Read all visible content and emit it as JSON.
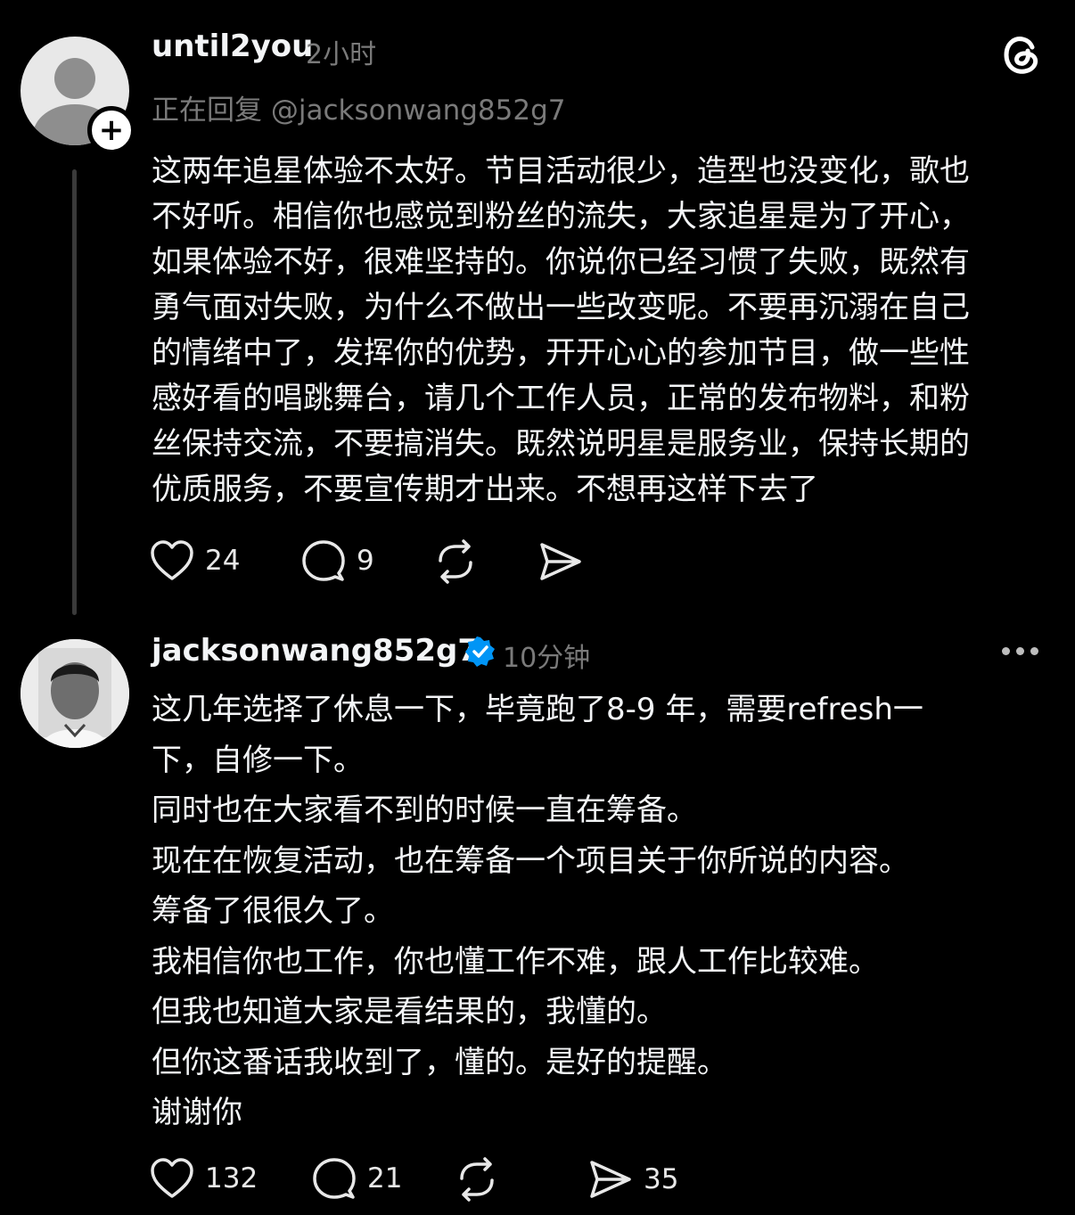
{
  "post": {
    "username": "until2you",
    "time": "2小时",
    "reply_to": "正在回复 @jacksonwang852g7",
    "lines": [
      "这两年追星体验不太好。节目活动很少，造型也没变化，歌也",
      "不好听。相信你也感觉到粉丝的流失，大家追星是为了开心，",
      "如果体验不好，很难坚持的。你说你已经习惯了失败，既然有",
      "勇气面对失败，为什么不做出一些改变呢。不要再沉溺在自己",
      "的情绪中了，发挥你的优势，开开心心的参加节目，做一些性",
      "感好看的唱跳舞台，请几个工作人员，正常的发布物料，和粉",
      "丝保持交流，不要搞消失。既然说明星是服务业，保持长期的",
      "优质服务，不要宣传期才出来。不想再这样下去了"
    ],
    "likes": "24",
    "replies": "9"
  },
  "reply": {
    "username": "jacksonwang852g7",
    "time": "10分钟",
    "lines": [
      "这几年选择了休息一下，毕竟跑了8-9 年，需要refresh一",
      "下，自修一下。",
      "同时也在大家看不到的时候一直在筹备。",
      "现在在恢复活动，也在筹备一个项目关于你所说的内容。",
      "筹备了很很久了。",
      "我相信你也工作，你也懂工作不难，跟人工作比较难。",
      "但我也知道大家是看结果的，我懂的。",
      "但你这番话我收到了，懂的。是好的提醒。",
      "谢谢你"
    ],
    "likes": "132",
    "replies": "21",
    "shares": "35"
  },
  "icons": {
    "like": "heart-icon",
    "comment": "comment-icon",
    "repost": "repost-icon",
    "share": "send-icon",
    "verified": "verified-badge-icon",
    "app": "threads-logo",
    "more": "more-icon"
  },
  "colors": {
    "background": "#000000",
    "text": "#f3f5f7",
    "muted": "#7a7a7a",
    "verified": "#0095f6"
  }
}
